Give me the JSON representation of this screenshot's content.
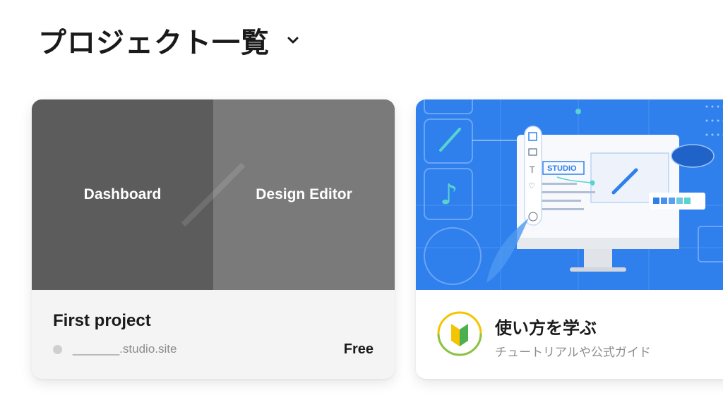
{
  "header": {
    "title": "プロジェクト一覧"
  },
  "projects": [
    {
      "thumbnail": {
        "left_label": "Dashboard",
        "right_label": "Design Editor"
      },
      "name": "First project",
      "domain": "_______.studio.site",
      "plan": "Free"
    }
  ],
  "guide": {
    "title": "使い方を学ぶ",
    "subtitle": "チュートリアルや公式ガイド",
    "illustration_text": "STUDIO"
  },
  "colors": {
    "guide_blue": "#2f80ed",
    "dashboard_gray": "#5c5c5c",
    "editor_gray": "#7a7a7a",
    "beginner_green": "#8bc34a",
    "beginner_yellow": "#f5c400"
  }
}
